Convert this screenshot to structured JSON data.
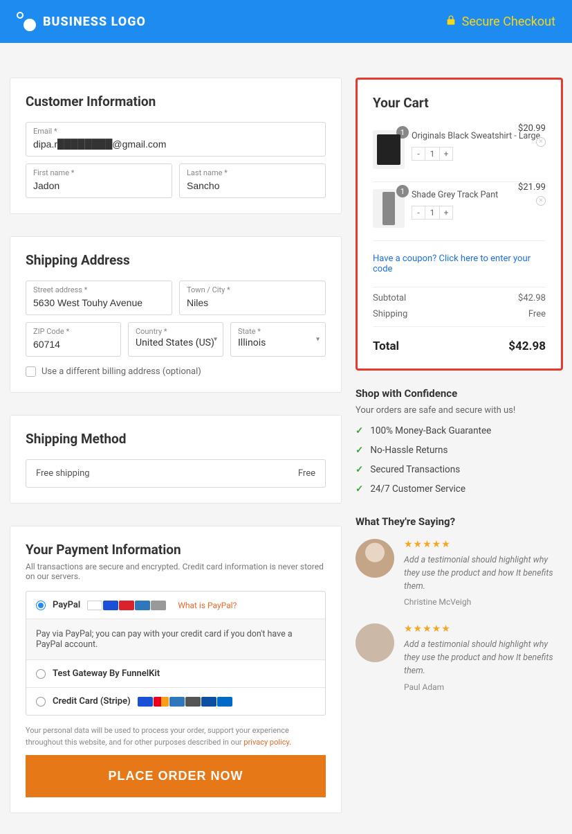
{
  "header": {
    "logo_text": "BUSINESS LOGO",
    "secure_text": "Secure Checkout"
  },
  "customer": {
    "heading": "Customer Information",
    "email_label": "Email *",
    "email_value": "dipa.r████████@gmail.com",
    "first_label": "First name *",
    "first_value": "Jadon",
    "last_label": "Last name *",
    "last_value": "Sancho"
  },
  "shipping": {
    "heading": "Shipping Address",
    "street_label": "Street address *",
    "street_value": "5630 West Touhy Avenue",
    "city_label": "Town / City *",
    "city_value": "Niles",
    "zip_label": "ZIP Code *",
    "zip_value": "60714",
    "country_label": "Country *",
    "country_value": "United States (US)",
    "state_label": "State *",
    "state_value": "Illinois",
    "diff_billing": "Use a different billing address (optional)"
  },
  "method": {
    "heading": "Shipping Method",
    "option_label": "Free shipping",
    "option_price": "Free"
  },
  "payment": {
    "heading": "Your Payment Information",
    "subtext": "All transactions are secure and encrypted. Credit card information is never stored on our servers.",
    "paypal_label": "PayPal",
    "what_paypal": "What is PayPal?",
    "paypal_desc": "Pay via PayPal; you can pay with your credit card if you don't have a PayPal account.",
    "gateway_label": "Test Gateway By FunnelKit",
    "stripe_label": "Credit Card (Stripe)",
    "privacy_text": "Your personal data will be used to process your order, support your experience throughout this website, and for other purposes described in our ",
    "privacy_link": "privacy policy",
    "place_order": "PLACE ORDER NOW"
  },
  "cart": {
    "heading": "Your Cart",
    "items": [
      {
        "name": "Originals Black Sweatshirt - Large",
        "qty": "1",
        "price": "$20.99"
      },
      {
        "name": "Shade Grey Track Pant",
        "qty": "1",
        "price": "$21.99"
      }
    ],
    "coupon_text": "Have a coupon? Click here to enter your code",
    "subtotal_label": "Subtotal",
    "subtotal_value": "$42.98",
    "shipping_label": "Shipping",
    "shipping_value": "Free",
    "total_label": "Total",
    "total_value": "$42.98"
  },
  "confidence": {
    "heading": "Shop with Confidence",
    "sub": "Your orders are safe and secure with us!",
    "benefits": [
      "100% Money-Back Guarantee",
      "No-Hassle Returns",
      "Secured Transactions",
      "24/7 Customer Service"
    ]
  },
  "testimonials": {
    "heading": "What They're Saying?",
    "items": [
      {
        "text": "Add a testimonial should highlight why they use the product and how It benefits them.",
        "name": "Christine McVeigh"
      },
      {
        "text": "Add a testimonial should highlight why they use the product and how It benefits them.",
        "name": "Paul Adam"
      }
    ]
  }
}
